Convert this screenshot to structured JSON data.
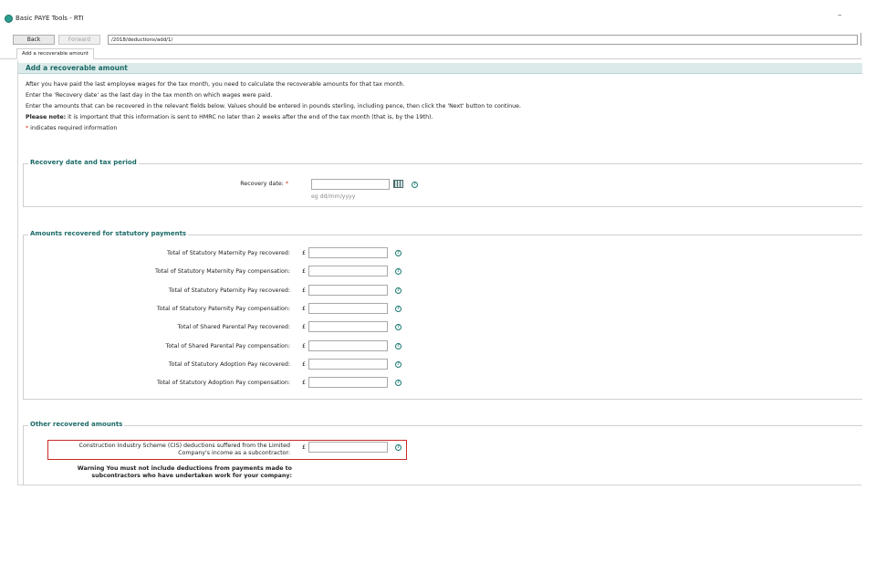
{
  "window": {
    "title": "Basic PAYE Tools - RTI",
    "minimize_glyph": "–"
  },
  "nav": {
    "back_label": "Back",
    "forward_label": "Forward",
    "url": "/2018/deductions/add/1/"
  },
  "tab": {
    "label": "Add a recoverable amount"
  },
  "page": {
    "heading": "Add a recoverable amount",
    "intro": [
      "After you have paid the last employee wages for the tax month, you need to calculate the recoverable amounts for that tax month.",
      "Enter the 'Recovery date' as the last day in the tax month on which wages were paid.",
      "Enter the amounts that can be recovered in the relevant fields below. Values should be entered in pounds sterling, including pence, then click the 'Next' button to continue."
    ],
    "note_bold": "Please note:",
    "note_text": " it is important that this information is sent to HMRC no later than 2 weeks after the end of the tax month (that is, by the 19th).",
    "required_star": "*",
    "required_text": " indicates required information"
  },
  "recovery": {
    "legend": "Recovery date and tax period",
    "label": "Recovery date:",
    "star": "*",
    "value": "",
    "hint": "eg dd/mm/yyyy",
    "icon": "calendar-icon"
  },
  "statutory": {
    "legend": "Amounts recovered for statutory payments",
    "currency": "£",
    "rows": [
      {
        "label": "Total of Statutory Maternity Pay recovered:",
        "value": ""
      },
      {
        "label": "Total of Statutory Maternity Pay compensation:",
        "value": ""
      },
      {
        "label": "Total of Statutory Paternity Pay recovered:",
        "value": ""
      },
      {
        "label": "Total of Statutory Paternity Pay compensation:",
        "value": ""
      },
      {
        "label": "Total of Shared Parental Pay recovered:",
        "value": ""
      },
      {
        "label": "Total of Shared Parental Pay compensation:",
        "value": ""
      },
      {
        "label": "Total of Statutory Adoption Pay recovered:",
        "value": ""
      },
      {
        "label": "Total of Statutory Adoption Pay compensation:",
        "value": ""
      }
    ]
  },
  "other": {
    "legend": "Other recovered amounts",
    "currency": "£",
    "cis_label_line1": "Construction Industry Scheme (CIS) deductions suffered from the Limited",
    "cis_label_line2": "Company's income as a subcontractor:",
    "cis_value": "",
    "warning_line1": "Warning You must not include deductions from payments made to",
    "warning_line2": "subcontractors who have undertaken work for your company:"
  },
  "colors": {
    "accent": "#1a6a66",
    "header_bg": "#dcebea",
    "required": "#d4351c",
    "error_border": "#c92a2a"
  }
}
